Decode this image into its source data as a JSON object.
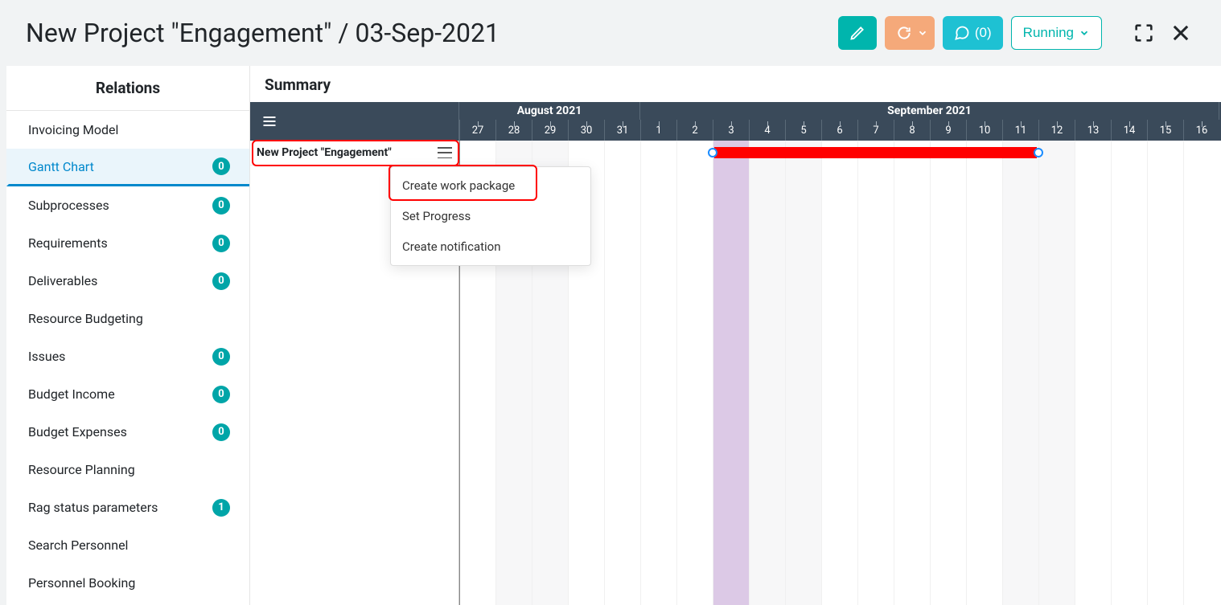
{
  "header": {
    "title": "New Project \"Engagement\" / 03-Sep-2021",
    "comments_label": "(0)",
    "status_label": "Running"
  },
  "sidebar": {
    "title": "Relations",
    "items": [
      {
        "label": "Invoicing Model",
        "count": null,
        "active": false
      },
      {
        "label": "Gantt Chart",
        "count": "0",
        "active": true
      },
      {
        "label": "Subprocesses",
        "count": "0",
        "active": false
      },
      {
        "label": "Requirements",
        "count": "0",
        "active": false
      },
      {
        "label": "Deliverables",
        "count": "0",
        "active": false
      },
      {
        "label": "Resource Budgeting",
        "count": null,
        "active": false
      },
      {
        "label": "Issues",
        "count": "0",
        "active": false
      },
      {
        "label": "Budget Income",
        "count": "0",
        "active": false
      },
      {
        "label": "Budget Expenses",
        "count": "0",
        "active": false
      },
      {
        "label": "Resource Planning",
        "count": null,
        "active": false
      },
      {
        "label": "Rag status parameters",
        "count": "1",
        "active": false
      },
      {
        "label": "Search Personnel",
        "count": null,
        "active": false
      },
      {
        "label": "Personnel Booking",
        "count": null,
        "active": false
      }
    ]
  },
  "main": {
    "section_title": "Summary",
    "task_name": "New Project \"Engagement\"",
    "timeline": {
      "months": [
        {
          "label": "August 2021",
          "span_days": 5
        },
        {
          "label": "September 2021",
          "span_days": 16
        }
      ],
      "days": [
        "27",
        "28",
        "29",
        "30",
        "31",
        "1",
        "2",
        "3",
        "4",
        "5",
        "6",
        "7",
        "8",
        "9",
        "10",
        "11",
        "12",
        "13",
        "14",
        "15",
        "16"
      ],
      "today_index": 7,
      "weekend_indices": [
        1,
        2,
        8,
        9,
        15,
        16
      ],
      "bar": {
        "start_index": 7,
        "end_index": 15
      }
    },
    "context_menu": {
      "items": [
        "Create work package",
        "Set Progress",
        "Create notification"
      ]
    }
  }
}
